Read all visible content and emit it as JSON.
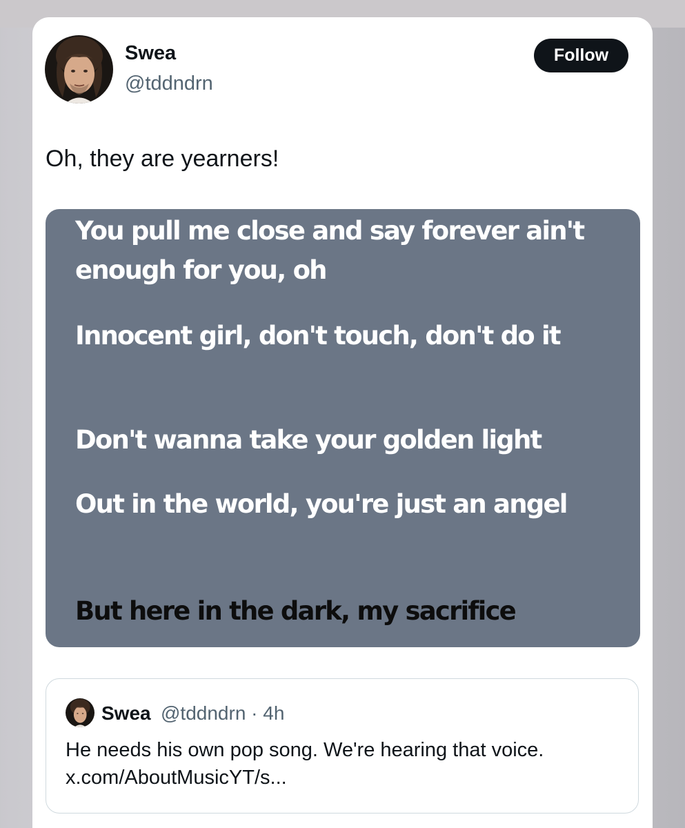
{
  "tweet": {
    "author_name": "Swea",
    "author_handle": "@tddndrn",
    "follow_label": "Follow",
    "text": "Oh, they are yearners!"
  },
  "media": {
    "lyrics": [
      {
        "text": "You pull me close and say forever ain't enough for you, oh",
        "state": "past"
      },
      {
        "text": "Innocent girl, don't touch, don't do it",
        "state": "past"
      },
      {
        "text": "Don't wanna take your golden light",
        "state": "past"
      },
      {
        "text": "Out in the world, you're just an angel",
        "state": "past"
      },
      {
        "text": "But here in the dark, my sacrifice",
        "state": "current"
      }
    ]
  },
  "quoted_tweet": {
    "author_name": "Swea",
    "meta": "@tddndrn · 4h",
    "body": "He needs his own pop song. We're hearing that voice. x.com/AboutMusicYT/s..."
  },
  "colors": {
    "follow_bg": "#0f1419",
    "media_bg": "#6b7686",
    "secondary_text": "#536471"
  }
}
